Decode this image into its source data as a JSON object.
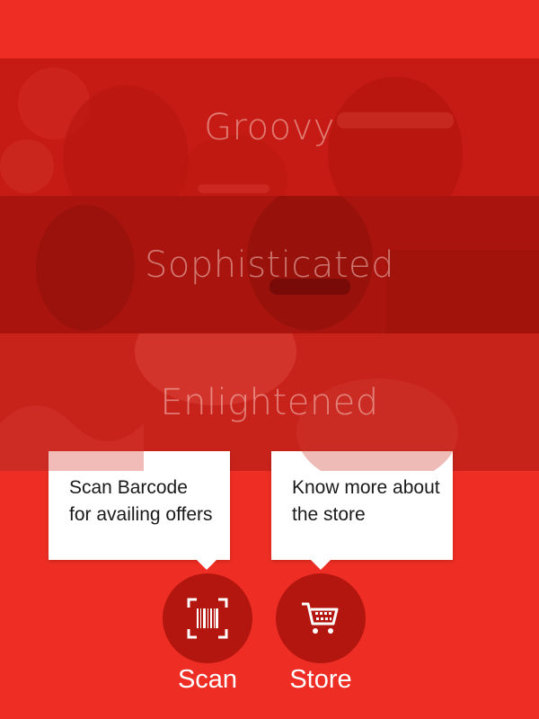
{
  "theme": {
    "accent": "#ee2e24",
    "button": "#b3160f"
  },
  "banners": [
    {
      "label": "Groovy"
    },
    {
      "label": "Sophisticated"
    },
    {
      "label": "Enlightened"
    }
  ],
  "tooltips": {
    "scan": "Scan Barcode\nfor availing offers",
    "store": "Know more about\nthe store"
  },
  "actions": {
    "scan": {
      "label": "Scan",
      "icon": "barcode-scan-icon"
    },
    "store": {
      "label": "Store",
      "icon": "shopping-cart-icon"
    }
  }
}
